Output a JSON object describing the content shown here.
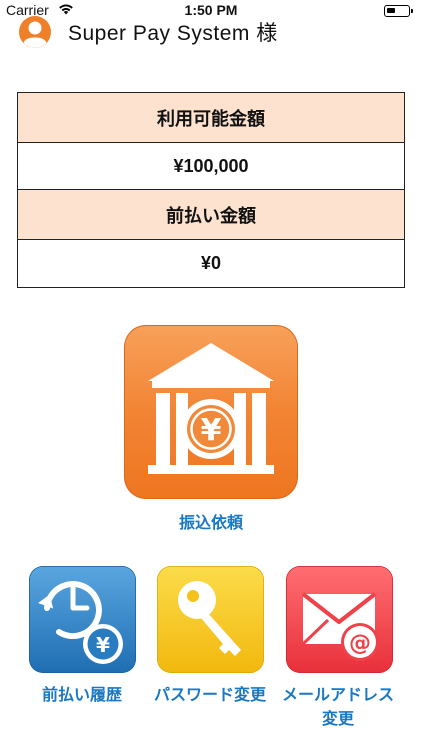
{
  "status_bar": {
    "carrier": "Carrier",
    "time": "1:50 PM"
  },
  "header": {
    "user_name": "Super Pay System 様"
  },
  "balance": {
    "available_label": "利用可能金額",
    "available_value": "¥100,000",
    "prepaid_label": "前払い金額",
    "prepaid_value": "¥0"
  },
  "menu": {
    "transfer_label": "振込依頼",
    "history_label": "前払い履歴",
    "password_label": "パスワード変更",
    "mail_label": "メールアドレス変更"
  },
  "icons": {
    "transfer": "bank-yen-icon",
    "history": "clock-yen-icon",
    "password": "key-icon",
    "mail": "mail-at-icon",
    "avatar": "user-avatar-icon"
  },
  "colors": {
    "accent_orange": "#f07f2a",
    "table_header_bg": "#fde3cf",
    "link_blue": "#1a78c2",
    "history_blue": "#2a7cc0",
    "password_yellow": "#f4c21a",
    "mail_red": "#f0404a"
  }
}
